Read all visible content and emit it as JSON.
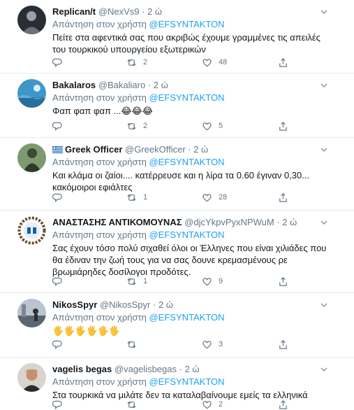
{
  "reply_label": "Απάντηση στον χρήστη",
  "tweets": [
    {
      "name": "Replican/t",
      "handle": "@NexVs9",
      "time": "2 ώ",
      "mention": "@EFSYNTAKTON",
      "text": "Πείτε στα αφεντικά σας που ακριβώς έχουμε γραμμένες τις απειλές του τουρκικού υπουργείου εξωτερικών",
      "retweets": "2",
      "likes": "48"
    },
    {
      "name": "Bakalaros",
      "handle": "@Bakaliaro",
      "time": "2 ώ",
      "mention": "@EFSYNTAKTON",
      "text": "Φαπ φαπ φαπ ...😂😂😂",
      "retweets": "2",
      "likes": "5"
    },
    {
      "name": "Greek Officer",
      "handle": "@GreekOfficer",
      "time": "2 ώ",
      "mention": "@EFSYNTAKTON",
      "text": "Και κλάμα οι ζαίοι.... κατέρρευσε και η λίρα τα 0.60 έγιναν 0,30... κακόμοιροι εφιάλτες",
      "retweets": "1",
      "likes": "28"
    },
    {
      "name": "ΑΝΑΣΤΑΣΗΣ ΑΝΤΙΚΟΜΟΥΝΑΣ",
      "handle": "@djcYkpvPyxNPWuM",
      "time": "2 ώ",
      "mention": "@EFSYNTAKTON",
      "text": "Σας έχουν τόσο πολύ σιχαθεί όλοι οι Έλληνες που είναι χιλιάδες που θα έδιναν την ζωή τους για να σας δουνε κρεμασμένους ρε βρωμιάρηδες δοσίλογοι προδότες.",
      "retweets": "1",
      "likes": "9"
    },
    {
      "name": "NikosSpyr",
      "handle": "@NikosSpyr",
      "time": "2 ώ",
      "mention": "@EFSYNTAKTON",
      "text": "🖐🖐🖐🖐🖐🖐",
      "retweets": "",
      "likes": "3"
    },
    {
      "name": "vagelis begas",
      "handle": "@vagelisbegas",
      "time": "2 ώ",
      "mention": "@EFSYNTAKTON",
      "text": "Στα τουρκικά να μιλάτε δεν τα καταλαβαίνουμε εμείς τα ελληνικά",
      "retweets": "",
      "likes": "2"
    }
  ]
}
